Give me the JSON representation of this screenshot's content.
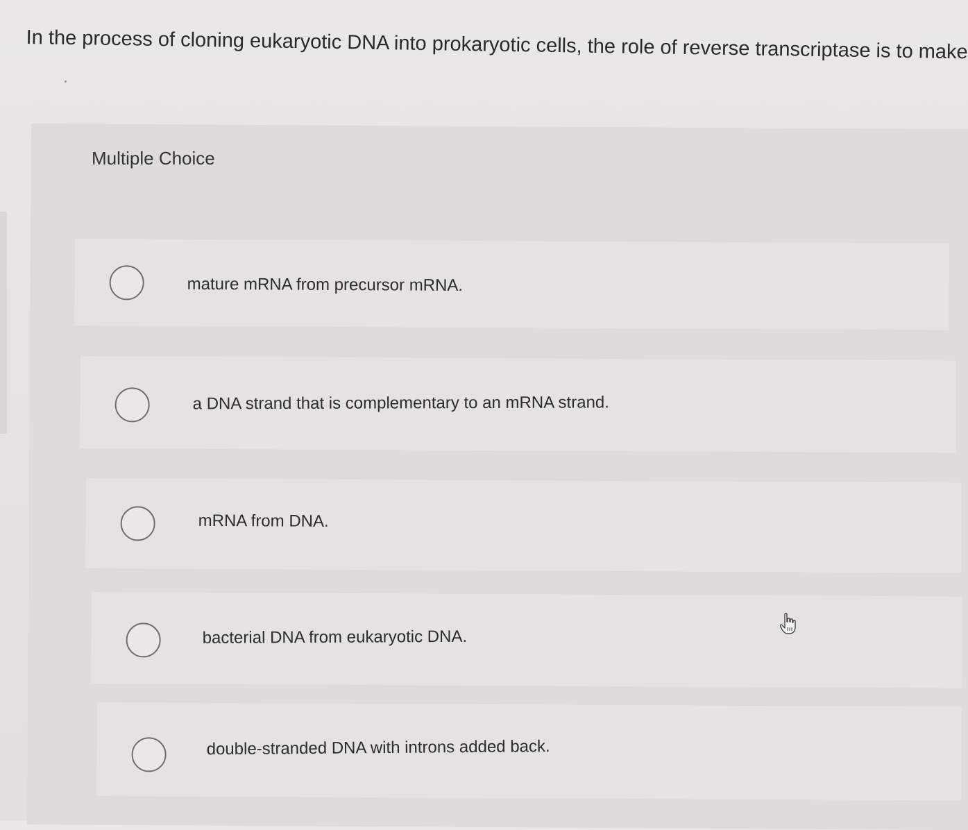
{
  "question": {
    "text": "In the process of cloning eukaryotic DNA into prokaryotic cells, the role of reverse transcriptase is to make"
  },
  "section": {
    "label": "Multiple Choice"
  },
  "options": [
    {
      "label": "mature mRNA from precursor mRNA."
    },
    {
      "label": "a DNA strand that is complementary to an mRNA strand."
    },
    {
      "label": "mRNA from DNA."
    },
    {
      "label": "bacterial DNA from eukaryotic DNA."
    },
    {
      "label": "double-stranded DNA with introns added back."
    }
  ],
  "icons": {
    "radio": "radio-unselected-icon",
    "cursor": "hand-pointer-icon"
  }
}
